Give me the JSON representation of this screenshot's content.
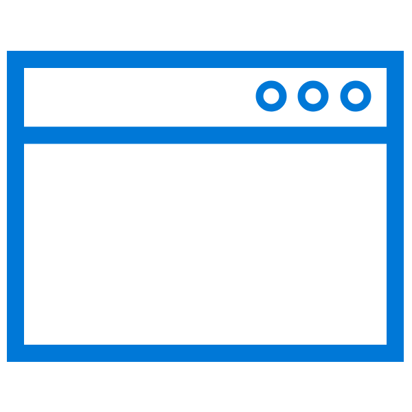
{
  "icon": {
    "name": "browser-window-icon",
    "color": "#0078D7",
    "background": "#FFFFFF",
    "title_bar_dot_count": 3
  }
}
